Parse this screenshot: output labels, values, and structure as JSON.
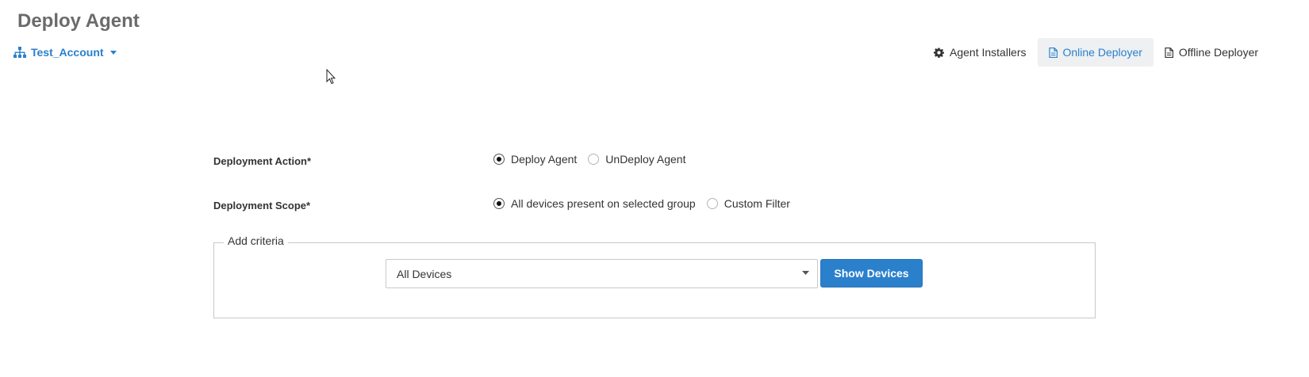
{
  "page": {
    "title": "Deploy Agent"
  },
  "account": {
    "name": "Test_Account"
  },
  "tabs": [
    {
      "label": "Agent Installers",
      "icon": "gear-icon",
      "active": false
    },
    {
      "label": "Online Deployer",
      "icon": "document-icon",
      "active": true
    },
    {
      "label": "Offline Deployer",
      "icon": "document-icon",
      "active": false
    }
  ],
  "form": {
    "deployment_action": {
      "label": "Deployment Action*",
      "options": [
        "Deploy Agent",
        "UnDeploy Agent"
      ],
      "selected": "Deploy Agent"
    },
    "deployment_scope": {
      "label": "Deployment Scope*",
      "options": [
        "All devices present on selected group",
        "Custom Filter"
      ],
      "selected": "All devices present on selected group"
    },
    "criteria": {
      "legend": "Add criteria",
      "select_value": "All Devices",
      "button_label": "Show Devices"
    }
  },
  "colors": {
    "accent": "#2b80cc",
    "title": "#6b6b6b",
    "active_tab_bg": "#eef0f2"
  }
}
